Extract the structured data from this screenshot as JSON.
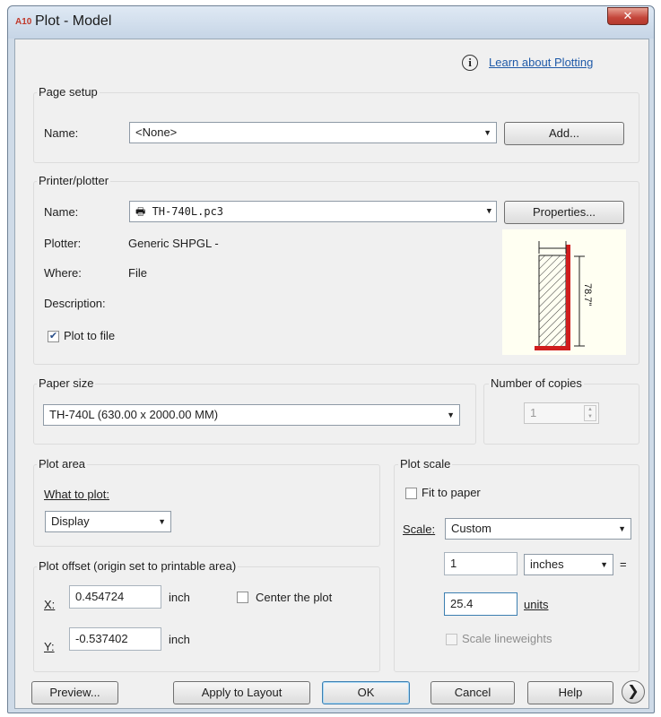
{
  "window": {
    "title": "Plot - Model",
    "app_icon_text": "A10",
    "close_glyph": "✕"
  },
  "help_link": {
    "icon": "info-icon",
    "icon_glyph": "i",
    "text": "Learn about Plotting"
  },
  "page_setup": {
    "group_title": "Page setup",
    "name_label": "Name:",
    "name_value": "<None>",
    "add_button": "Add..."
  },
  "printer": {
    "group_title": "Printer/plotter",
    "name_label": "Name:",
    "name_value": "TH-740L.pc3",
    "device_icon": "plotter-icon",
    "properties_button": "Properties...",
    "plotter_label": "Plotter:",
    "plotter_value": "Generic SHPGL -",
    "where_label": "Where:",
    "where_value": "File",
    "description_label": "Description:",
    "plot_to_file_label": "Plot to file",
    "plot_to_file_checked": true,
    "preview_dimension": "78.7\""
  },
  "paper_size": {
    "group_title": "Paper size",
    "value": "TH-740L (630.00 x 2000.00 MM)"
  },
  "copies": {
    "group_title": "Number of copies",
    "value": "1"
  },
  "plot_area": {
    "group_title": "Plot area",
    "what_label": "What to plot:",
    "what_value": "Display"
  },
  "plot_offset": {
    "group_title": "Plot offset (origin set to printable area)",
    "x_label": "X:",
    "x_value": "0.454724",
    "x_unit": "inch",
    "y_label": "Y:",
    "y_value": "-0.537402",
    "y_unit": "inch",
    "center_label": "Center the plot",
    "center_checked": false
  },
  "plot_scale": {
    "group_title": "Plot scale",
    "fit_label": "Fit to paper",
    "fit_checked": false,
    "scale_label": "Scale:",
    "scale_value": "Custom",
    "value1": "1",
    "unit1": "inches",
    "equals": "=",
    "value2": "25.4",
    "unit2": "units",
    "lineweights_label": "Scale lineweights",
    "lineweights_checked": false
  },
  "buttons": {
    "preview": "Preview...",
    "apply": "Apply to Layout",
    "ok": "OK",
    "cancel": "Cancel",
    "help": "Help",
    "expand_glyph": "❯"
  },
  "colors": {
    "accent_red": "#d01e1e",
    "link_blue": "#1f5aa8",
    "window_frame": "#cfdbe8"
  }
}
